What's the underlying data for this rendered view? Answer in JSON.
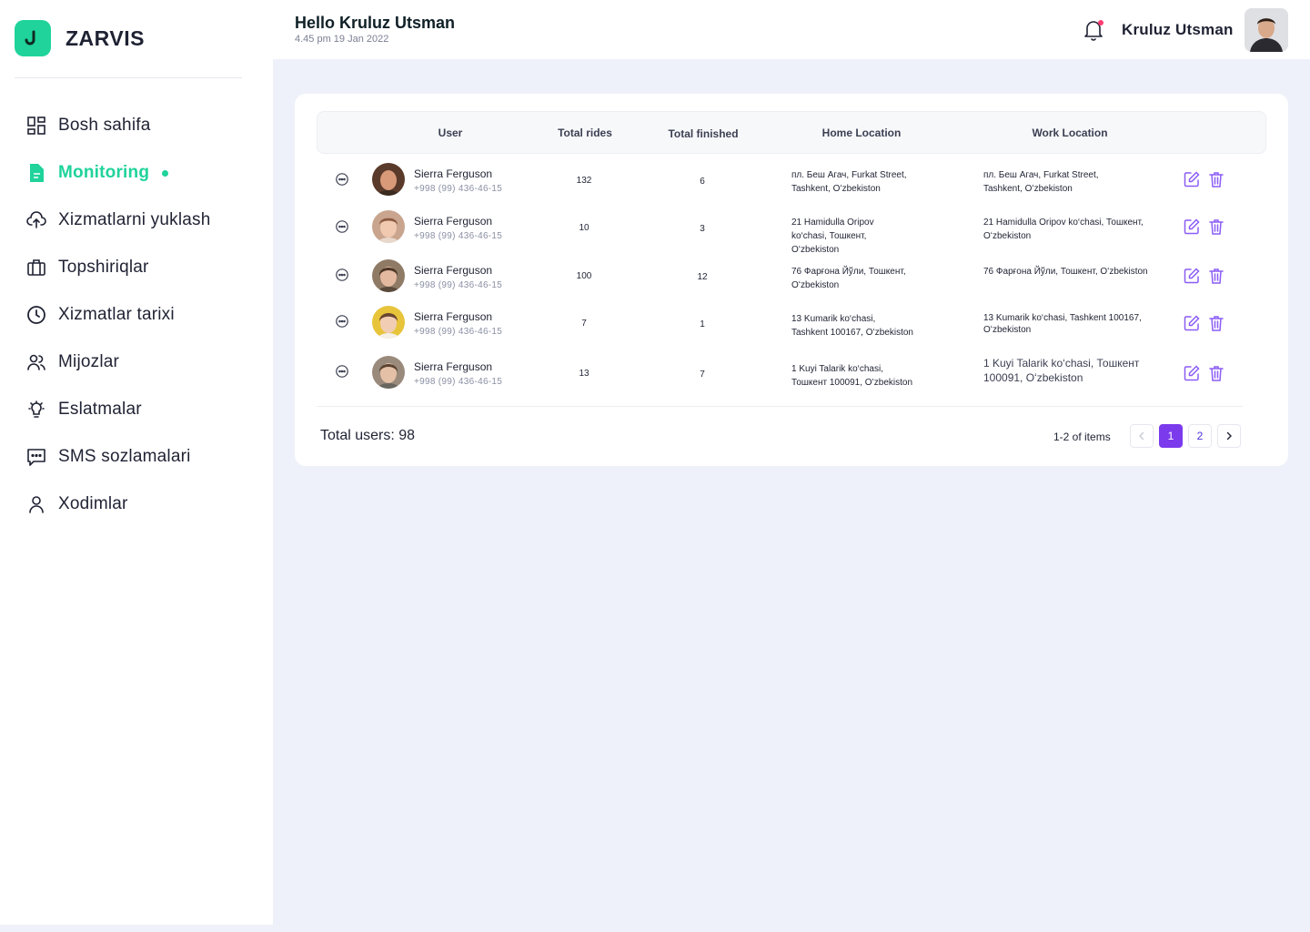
{
  "brand": {
    "name": "ZARVIS",
    "accent": "#1fd39b"
  },
  "sidebar": {
    "items": [
      {
        "label": "Bosh sahifa",
        "icon": "dashboard-icon"
      },
      {
        "label": "Monitoring",
        "icon": "document-icon",
        "active": true
      },
      {
        "label": "Xizmatlarni yuklash",
        "icon": "cloud-upload-icon"
      },
      {
        "label": "Topshiriqlar",
        "icon": "briefcase-icon"
      },
      {
        "label": "Xizmatlar tarixi",
        "icon": "clock-icon"
      },
      {
        "label": "Mijozlar",
        "icon": "users-icon"
      },
      {
        "label": "Eslatmalar",
        "icon": "lightbulb-icon"
      },
      {
        "label": "SMS sozlamalari",
        "icon": "message-icon"
      },
      {
        "label": "Xodimlar",
        "icon": "user-icon"
      }
    ]
  },
  "header": {
    "greeting": "Hello Kruluz Utsman",
    "datetime": "4.45 pm 19 Jan 2022",
    "user_name": "Kruluz Utsman"
  },
  "table": {
    "columns": [
      "User",
      "Total rides",
      "Total finished",
      "Home Location",
      "Work Location"
    ],
    "rows": [
      {
        "name": "Sierra Ferguson",
        "phone": "+998 (99) 436-46-15",
        "total_rides": "132",
        "total_finished": "6",
        "home": [
          "пл. Беш Агач, Furkat Street,",
          "Tashkent, Oʻzbekiston"
        ],
        "work": [
          "пл. Беш Агач, Furkat Street,",
          "Tashkent, Oʻzbekiston"
        ]
      },
      {
        "name": "Sierra Ferguson",
        "phone": "+998 (99) 436-46-15",
        "total_rides": "10",
        "total_finished": "3",
        "home": [
          "21 Hamidulla Oripov",
          "ko‘chasi, Тошкент,",
          "Oʻzbekiston"
        ],
        "work": [
          "21 Hamidulla Oripov ko‘chasi, Тошкент,",
          "Oʻzbekiston"
        ]
      },
      {
        "name": "Sierra Ferguson",
        "phone": "+998 (99) 436-46-15",
        "total_rides": "100",
        "total_finished": "12",
        "home": [
          "76 Фарғона Йўли, Тошкент,",
          "Oʻzbekiston"
        ],
        "work": [
          "76 Фарғона Йўли, Тошкент, Oʻzbekiston"
        ]
      },
      {
        "name": "Sierra Ferguson",
        "phone": "+998 (99) 436-46-15",
        "total_rides": "7",
        "total_finished": "1",
        "home": [
          "13 Kumarik ko‘chasi,",
          "Tashkent 100167, Oʻzbekiston"
        ],
        "work": [
          "13 Kumarik ko‘chasi, Tashkent 100167,",
          "Oʻzbekiston"
        ]
      },
      {
        "name": "Sierra Ferguson",
        "phone": "+998 (99) 436-46-15",
        "total_rides": "13",
        "total_finished": "7",
        "home": [
          "1 Kuyi Talarik ko‘chasi,",
          "Тошкент 100091, Oʻzbekiston"
        ],
        "work": [
          "1 Kuyi Talarik ko‘chasi, Тошкент",
          "100091, Oʻzbekiston"
        ]
      }
    ],
    "total_users": "Total users: 98",
    "items_info": "1-2 of items",
    "pages": [
      "1",
      "2"
    ],
    "current_page": "1"
  },
  "colors": {
    "primary": "#7c3aed",
    "accent": "#1fd39b",
    "notification": "#ff3d71"
  }
}
